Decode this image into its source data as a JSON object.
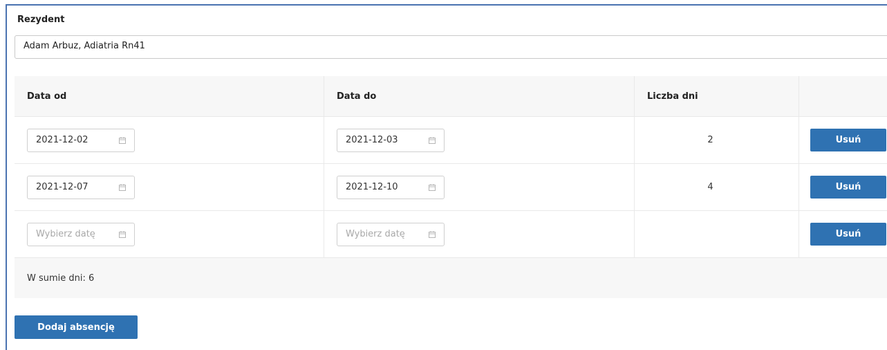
{
  "resident": {
    "label": "Rezydent",
    "value": "Adam Arbuz, Adiatria Rn41"
  },
  "table": {
    "headers": {
      "date_from": "Data od",
      "date_to": "Data do",
      "days": "Liczba dni",
      "actions": ""
    },
    "rows": [
      {
        "date_from": "2021-12-02",
        "date_to": "2021-12-03",
        "days": "2",
        "remove_label": "Usuń"
      },
      {
        "date_from": "2021-12-07",
        "date_to": "2021-12-10",
        "days": "4",
        "remove_label": "Usuń"
      },
      {
        "date_from": "",
        "date_to": "",
        "days": "",
        "remove_label": "Usuń"
      }
    ],
    "date_placeholder": "Wybierz datę",
    "total_text": "W sumie dni: 6"
  },
  "add_button_label": "Dodaj absencję",
  "colors": {
    "accent": "#2f72b2",
    "frame_border": "#4a72b0",
    "header_bg": "#f7f7f7"
  },
  "icons": {
    "date_field": "calendar-icon"
  }
}
